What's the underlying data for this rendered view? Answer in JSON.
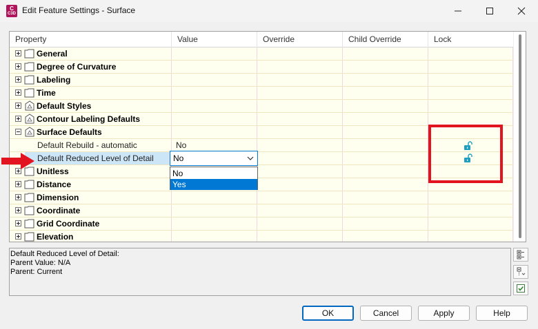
{
  "window": {
    "app_icon_text": "C",
    "app_icon_sub": "C3D",
    "title": "Edit Feature Settings - Surface",
    "controls": [
      "minimize-icon",
      "maximize-icon",
      "close-icon"
    ]
  },
  "grid": {
    "columns": [
      "Property",
      "Value",
      "Override",
      "Child Override",
      "Lock"
    ],
    "rows": [
      {
        "label": "General",
        "kind": "group",
        "expanded": false,
        "icon": "document-icon"
      },
      {
        "label": "Degree of Curvature",
        "kind": "group",
        "expanded": false,
        "icon": "document-icon"
      },
      {
        "label": "Labeling",
        "kind": "group",
        "expanded": false,
        "icon": "document-icon"
      },
      {
        "label": "Time",
        "kind": "group",
        "expanded": false,
        "icon": "document-icon"
      },
      {
        "label": "Default Styles",
        "kind": "group",
        "expanded": false,
        "icon": "styles-icon"
      },
      {
        "label": "Contour Labeling Defaults",
        "kind": "group",
        "expanded": false,
        "icon": "styles-icon"
      },
      {
        "label": "Surface Defaults",
        "kind": "group",
        "expanded": true,
        "icon": "styles-icon"
      },
      {
        "label": "Default Rebuild - automatic",
        "kind": "child",
        "value": "No",
        "locked": false
      },
      {
        "label": "Default Reduced Level of Detail",
        "kind": "child",
        "value": "No",
        "locked": false,
        "selected": true
      },
      {
        "label": "Unitless",
        "kind": "group",
        "expanded": false,
        "icon": "document-icon"
      },
      {
        "label": "Distance",
        "kind": "group",
        "expanded": false,
        "icon": "document-icon"
      },
      {
        "label": "Dimension",
        "kind": "group",
        "expanded": false,
        "icon": "document-icon"
      },
      {
        "label": "Coordinate",
        "kind": "group",
        "expanded": false,
        "icon": "document-icon"
      },
      {
        "label": "Grid Coordinate",
        "kind": "group",
        "expanded": false,
        "icon": "document-icon"
      },
      {
        "label": "Elevation",
        "kind": "group",
        "expanded": false,
        "icon": "document-icon"
      }
    ],
    "dropdown": {
      "current": "No",
      "options": [
        "No",
        "Yes"
      ],
      "highlighted": "Yes"
    }
  },
  "description": {
    "lines": [
      "Default Reduced Level of Detail:",
      "Parent Value: N/A",
      "Parent: Current"
    ]
  },
  "side_buttons": [
    "expand-all-icon",
    "collapse-all-icon",
    "checkbox-icon"
  ],
  "buttons": {
    "ok": "OK",
    "cancel": "Cancel",
    "apply": "Apply",
    "help": "Help"
  },
  "colors": {
    "accent": "#0078d4",
    "highlight_box": "#e1141f",
    "row_background": "#fffff0",
    "lock_icon": "#1f9fbf"
  }
}
